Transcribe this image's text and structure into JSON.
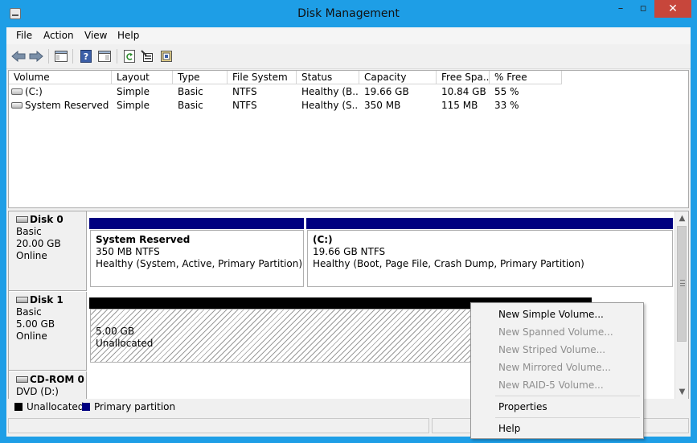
{
  "window": {
    "title": "Disk Management",
    "min_glyph": "–",
    "max_glyph": "▫",
    "close_glyph": "✕"
  },
  "menubar": {
    "items": [
      "File",
      "Action",
      "View",
      "Help"
    ]
  },
  "toolbar": {
    "icons": [
      "back-icon",
      "forward-icon",
      "console-tree-icon",
      "help-icon",
      "properties-pane-icon",
      "refresh-icon",
      "properties-icon",
      "rescan-disks-icon"
    ]
  },
  "volumes": {
    "columns": [
      "Volume",
      "Layout",
      "Type",
      "File System",
      "Status",
      "Capacity",
      "Free Spa...",
      "% Free"
    ],
    "rows": [
      [
        "(C:)",
        "Simple",
        "Basic",
        "NTFS",
        "Healthy (B...",
        "19.66 GB",
        "10.84 GB",
        "55 %"
      ],
      [
        "System Reserved",
        "Simple",
        "Basic",
        "NTFS",
        "Healthy (S...",
        "350 MB",
        "115 MB",
        "33 %"
      ]
    ]
  },
  "disks": [
    {
      "name": "Disk 0",
      "type": "Basic",
      "size": "20.00 GB",
      "status": "Online",
      "partitions": [
        {
          "name": "System Reserved",
          "detail": "350 MB NTFS",
          "health": "Healthy (System, Active, Primary Partition)"
        },
        {
          "name": "(C:)",
          "detail": "19.66 GB NTFS",
          "health": "Healthy (Boot, Page File, Crash Dump, Primary Partition)"
        }
      ]
    },
    {
      "name": "Disk 1",
      "type": "Basic",
      "size": "5.00 GB",
      "status": "Online",
      "partitions": [
        {
          "name": "",
          "detail": "5.00 GB",
          "health": "Unallocated"
        }
      ]
    },
    {
      "name": "CD-ROM 0",
      "type": "DVD (D:)"
    }
  ],
  "legend": {
    "unallocated": "Unallocated",
    "primary": "Primary partition",
    "unallocated_color": "#000000",
    "primary_color": "#000080"
  },
  "context_menu": {
    "items": [
      {
        "label": "New Simple Volume...",
        "enabled": true
      },
      {
        "label": "New Spanned Volume...",
        "enabled": false
      },
      {
        "label": "New Striped Volume...",
        "enabled": false
      },
      {
        "label": "New Mirrored Volume...",
        "enabled": false
      },
      {
        "label": "New RAID-5 Volume...",
        "enabled": false
      },
      {
        "label": "Properties",
        "enabled": true
      },
      {
        "label": "Help",
        "enabled": true
      }
    ]
  },
  "colors": {
    "titlebar": "#1e9ee6",
    "primary_partition": "#000080",
    "close_button": "#c7463b"
  }
}
